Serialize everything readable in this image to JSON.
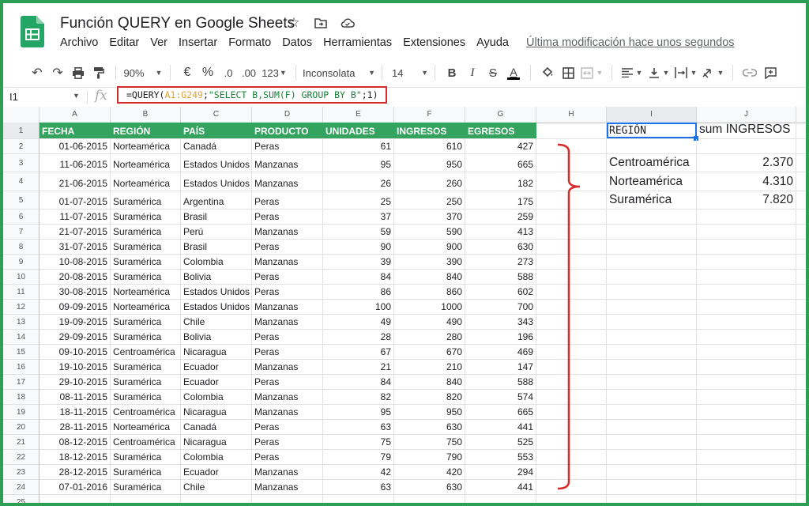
{
  "doc": {
    "title": "Función QUERY en Google Sheets",
    "menus": [
      "Archivo",
      "Editar",
      "Ver",
      "Insertar",
      "Formato",
      "Datos",
      "Herramientas",
      "Extensiones",
      "Ayuda"
    ],
    "last_edit": "Última modificación hace unos segundos"
  },
  "toolbar": {
    "zoom": "90%",
    "currency": "€",
    "percent": "%",
    "dec_less": ".0",
    "dec_more": ".00",
    "format": "123",
    "font": "Inconsolata",
    "size": "14",
    "bold": "B",
    "italic": "I",
    "strike": "S",
    "text_color": "A"
  },
  "formula_bar": {
    "cell_ref": "I1",
    "fx": "fx",
    "formula_prefix": "=QUERY(",
    "formula_range": "A1:G249",
    "formula_sep": ";",
    "formula_query": "\"SELECT B,SUM(F) GROUP BY B\"",
    "formula_tail": ";1)"
  },
  "columns": [
    "A",
    "B",
    "C",
    "D",
    "E",
    "F",
    "G",
    "H",
    "I",
    "J"
  ],
  "headers": [
    "FECHA",
    "REGIÓN",
    "PAÍS",
    "PRODUCTO",
    "UNIDADES",
    "INGRESOS",
    "EGRESOS"
  ],
  "rows": [
    [
      "01-06-2015",
      "Norteamérica",
      "Canadá",
      "Peras",
      "61",
      "610",
      "427"
    ],
    [
      "11-06-2015",
      "Norteamérica",
      "Estados Unidos",
      "Manzanas",
      "95",
      "950",
      "665"
    ],
    [
      "21-06-2015",
      "Norteamérica",
      "Estados Unidos",
      "Manzanas",
      "26",
      "260",
      "182"
    ],
    [
      "01-07-2015",
      "Suramérica",
      "Argentina",
      "Peras",
      "25",
      "250",
      "175"
    ],
    [
      "11-07-2015",
      "Suramérica",
      "Brasil",
      "Peras",
      "37",
      "370",
      "259"
    ],
    [
      "21-07-2015",
      "Suramérica",
      "Perú",
      "Manzanas",
      "59",
      "590",
      "413"
    ],
    [
      "31-07-2015",
      "Suramérica",
      "Brasil",
      "Peras",
      "90",
      "900",
      "630"
    ],
    [
      "10-08-2015",
      "Suramérica",
      "Colombia",
      "Manzanas",
      "39",
      "390",
      "273"
    ],
    [
      "20-08-2015",
      "Suramérica",
      "Bolivia",
      "Peras",
      "84",
      "840",
      "588"
    ],
    [
      "30-08-2015",
      "Norteamérica",
      "Estados Unidos",
      "Peras",
      "86",
      "860",
      "602"
    ],
    [
      "09-09-2015",
      "Norteamérica",
      "Estados Unidos",
      "Manzanas",
      "100",
      "1000",
      "700"
    ],
    [
      "19-09-2015",
      "Suramérica",
      "Chile",
      "Manzanas",
      "49",
      "490",
      "343"
    ],
    [
      "29-09-2015",
      "Suramérica",
      "Bolivia",
      "Peras",
      "28",
      "280",
      "196"
    ],
    [
      "09-10-2015",
      "Centroamérica",
      "Nicaragua",
      "Peras",
      "67",
      "670",
      "469"
    ],
    [
      "19-10-2015",
      "Suramérica",
      "Ecuador",
      "Manzanas",
      "21",
      "210",
      "147"
    ],
    [
      "29-10-2015",
      "Suramérica",
      "Ecuador",
      "Peras",
      "84",
      "840",
      "588"
    ],
    [
      "08-11-2015",
      "Suramérica",
      "Colombia",
      "Manzanas",
      "82",
      "820",
      "574"
    ],
    [
      "18-11-2015",
      "Centroamérica",
      "Nicaragua",
      "Manzanas",
      "95",
      "950",
      "665"
    ],
    [
      "28-11-2015",
      "Norteamérica",
      "Canadá",
      "Peras",
      "63",
      "630",
      "441"
    ],
    [
      "08-12-2015",
      "Centroamérica",
      "Nicaragua",
      "Peras",
      "75",
      "750",
      "525"
    ],
    [
      "18-12-2015",
      "Suramérica",
      "Colombia",
      "Peras",
      "79",
      "790",
      "553"
    ],
    [
      "28-12-2015",
      "Suramérica",
      "Ecuador",
      "Manzanas",
      "42",
      "420",
      "294"
    ],
    [
      "07-01-2016",
      "Suramérica",
      "Chile",
      "Manzanas",
      "63",
      "630",
      "441"
    ]
  ],
  "result": {
    "header_region": "REGIÓN",
    "header_sum": "sum INGRESOS",
    "items": [
      {
        "region": "Centroamérica",
        "sum": "2.370"
      },
      {
        "region": "Norteamérica",
        "sum": "4.310"
      },
      {
        "region": "Suramérica",
        "sum": "7.820"
      }
    ]
  },
  "colors": {
    "header_green": "#34a360",
    "frame_green": "#2e9e55",
    "annotation_red": "#d62b2b",
    "selection_blue": "#1a73e8"
  }
}
